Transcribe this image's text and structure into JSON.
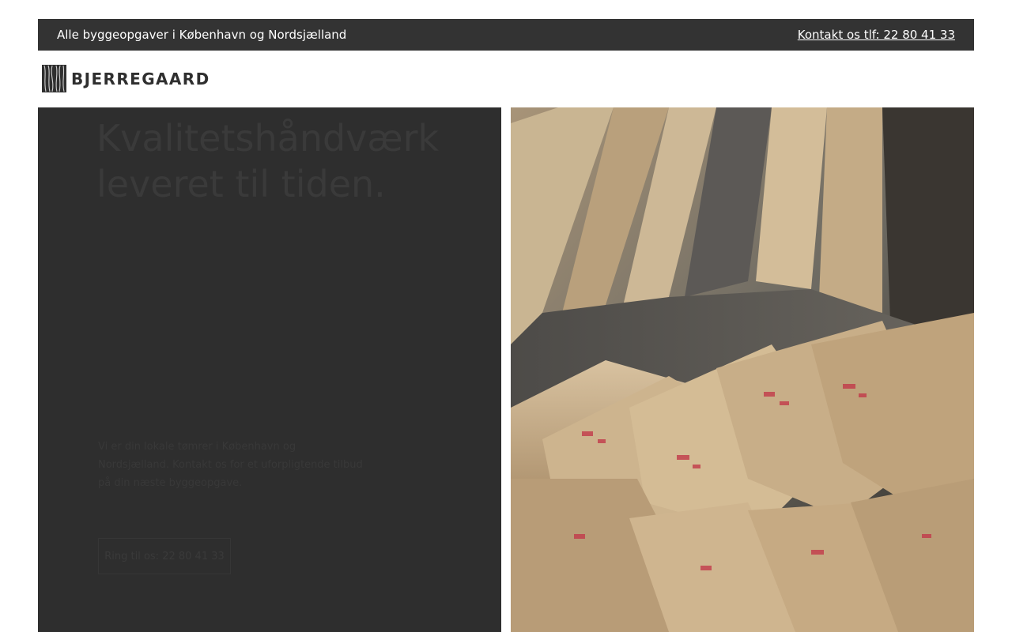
{
  "topbar": {
    "tagline": "Alle byggeopgaver i København og Nordsjælland",
    "contact_link": "Kontakt os tlf: 22 80 41 33"
  },
  "logo": {
    "text": "BJERREGAARD"
  },
  "hero": {
    "title": "Kvalitetshåndværk leveret til tiden.",
    "body": "Vi er din lokale tømrer i København og Nordsjælland. Kontakt os for et uforpligtende tilbud på din næste byggeopgave.",
    "button_label": "Ring til os: 22 80 41 33",
    "image_alt": "Stablede træplanker"
  },
  "colors": {
    "topbar_bg": "#333333",
    "hero_bg": "#2e2e2e",
    "logo_text": "#2f2f2f"
  }
}
